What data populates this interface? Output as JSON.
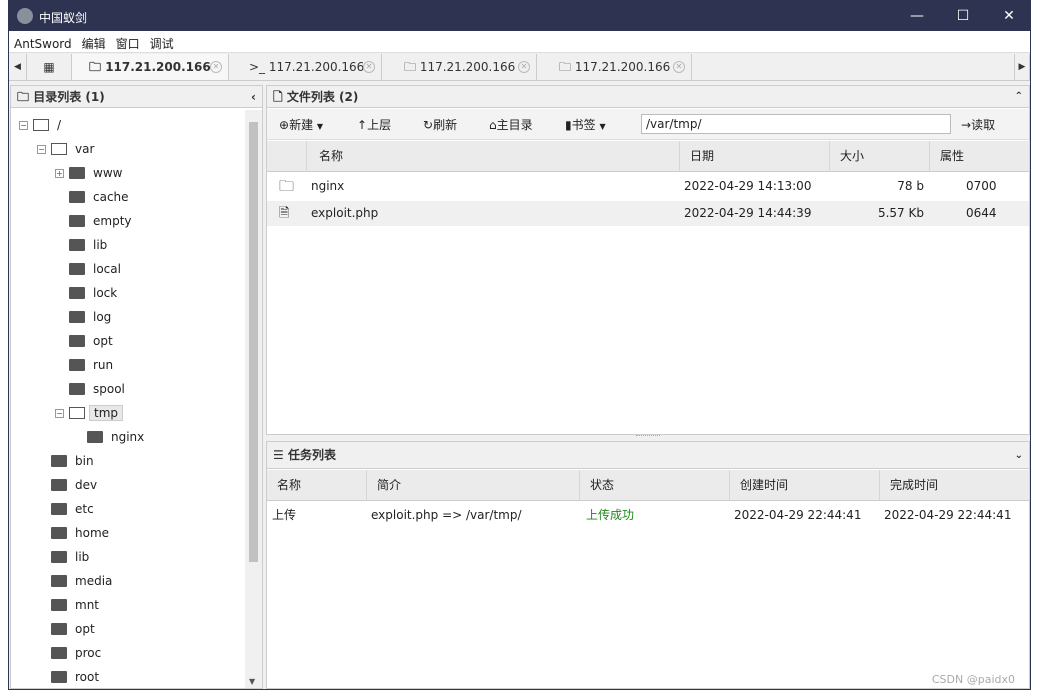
{
  "window": {
    "title": "中国蚁剑",
    "minimize": "—",
    "maximize": "☐",
    "close": "✕"
  },
  "menu": [
    "AntSword",
    "编辑",
    "窗口",
    "调试"
  ],
  "tabs": [
    {
      "label": "117.21.200.166",
      "icon": "folder-icon",
      "active": true
    },
    {
      "label": "117.21.200.166",
      "icon": "terminal-icon",
      "prefix": ">_"
    },
    {
      "label": "117.21.200.166",
      "icon": "folder-icon"
    },
    {
      "label": "117.21.200.166",
      "icon": "folder-icon"
    }
  ],
  "dir_panel": {
    "title": "目录列表 (1)",
    "tree": [
      {
        "label": "/",
        "depth": 0,
        "open": true
      },
      {
        "label": "var",
        "depth": 1,
        "open": true
      },
      {
        "label": "www",
        "depth": 2,
        "expandable": true
      },
      {
        "label": "cache",
        "depth": 2
      },
      {
        "label": "empty",
        "depth": 2
      },
      {
        "label": "lib",
        "depth": 2
      },
      {
        "label": "local",
        "depth": 2
      },
      {
        "label": "lock",
        "depth": 2
      },
      {
        "label": "log",
        "depth": 2
      },
      {
        "label": "opt",
        "depth": 2
      },
      {
        "label": "run",
        "depth": 2
      },
      {
        "label": "spool",
        "depth": 2
      },
      {
        "label": "tmp",
        "depth": 2,
        "open": true,
        "selected": true
      },
      {
        "label": "nginx",
        "depth": 3
      },
      {
        "label": "bin",
        "depth": 1
      },
      {
        "label": "dev",
        "depth": 1
      },
      {
        "label": "etc",
        "depth": 1
      },
      {
        "label": "home",
        "depth": 1
      },
      {
        "label": "lib",
        "depth": 1
      },
      {
        "label": "media",
        "depth": 1
      },
      {
        "label": "mnt",
        "depth": 1
      },
      {
        "label": "opt",
        "depth": 1
      },
      {
        "label": "proc",
        "depth": 1
      },
      {
        "label": "root",
        "depth": 1
      }
    ]
  },
  "file_panel": {
    "title": "文件列表 (2)",
    "toolbar": {
      "new": "新建",
      "up": "上层",
      "refresh": "刷新",
      "home": "主目录",
      "bookmark": "书签",
      "path": "/var/tmp/",
      "read": "读取"
    },
    "columns": [
      "名称",
      "日期",
      "大小",
      "属性"
    ],
    "rows": [
      {
        "icon": "folder-icon",
        "name": "nginx",
        "date": "2022-04-29 14:13:00",
        "size": "78 b",
        "perm": "0700"
      },
      {
        "icon": "php-file-icon",
        "name": "exploit.php",
        "date": "2022-04-29 14:44:39",
        "size": "5.57 Kb",
        "perm": "0644"
      }
    ]
  },
  "task_panel": {
    "title": "任务列表",
    "columns": [
      "名称",
      "简介",
      "状态",
      "创建时间",
      "完成时间"
    ],
    "rows": [
      {
        "name": "上传",
        "desc": "exploit.php => /var/tmp/",
        "status": "上传成功",
        "created": "2022-04-29 22:44:41",
        "finished": "2022-04-29 22:44:41"
      }
    ]
  },
  "colors": {
    "titlebar": "#2d3350",
    "success": "#1a8a1a"
  },
  "watermark": "CSDN @paidx0"
}
